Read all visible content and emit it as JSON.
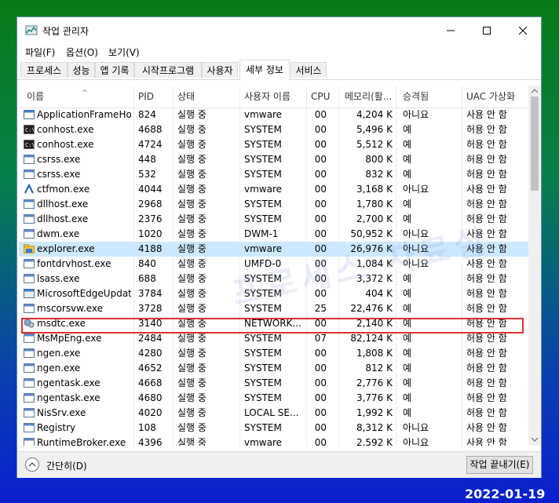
{
  "window": {
    "title": "작업 관리자",
    "controls": [
      "minimize-icon",
      "maximize-icon",
      "close-icon"
    ]
  },
  "menu": [
    "파일(F)",
    "옵션(O)",
    "보기(V)"
  ],
  "tabs": [
    "프로세스",
    "성능",
    "앱 기록",
    "시작프로그램",
    "사용자",
    "세부 정보",
    "서비스"
  ],
  "active_tab": "세부 정보",
  "columns": [
    "이름",
    "PID",
    "상태",
    "사용자 이름",
    "CPU",
    "메모리(활...",
    "승격됨",
    "UAC 가상화"
  ],
  "rows": [
    {
      "icon": "app-frame-icon",
      "name": "ApplicationFrameHo...",
      "pid": "824",
      "status": "실행 중",
      "user": "vmware",
      "cpu": "00",
      "mem": "4,204 K",
      "elev": "아니요",
      "uac": "사용 안 함"
    },
    {
      "icon": "console-icon",
      "name": "conhost.exe",
      "pid": "4688",
      "status": "실행 중",
      "user": "SYSTEM",
      "cpu": "00",
      "mem": "5,496 K",
      "elev": "예",
      "uac": "허용 안 함"
    },
    {
      "icon": "console-icon",
      "name": "conhost.exe",
      "pid": "4724",
      "status": "실행 중",
      "user": "SYSTEM",
      "cpu": "00",
      "mem": "5,512 K",
      "elev": "예",
      "uac": "허용 안 함"
    },
    {
      "icon": "window-icon",
      "name": "csrss.exe",
      "pid": "448",
      "status": "실행 중",
      "user": "SYSTEM",
      "cpu": "00",
      "mem": "800 K",
      "elev": "예",
      "uac": "허용 안 함"
    },
    {
      "icon": "window-icon",
      "name": "csrss.exe",
      "pid": "532",
      "status": "실행 중",
      "user": "SYSTEM",
      "cpu": "00",
      "mem": "832 K",
      "elev": "예",
      "uac": "허용 안 함"
    },
    {
      "icon": "ctfmon-icon",
      "name": "ctfmon.exe",
      "pid": "4044",
      "status": "실행 중",
      "user": "vmware",
      "cpu": "00",
      "mem": "3,168 K",
      "elev": "아니요",
      "uac": "사용 안 함"
    },
    {
      "icon": "window-icon",
      "name": "dllhost.exe",
      "pid": "2968",
      "status": "실행 중",
      "user": "SYSTEM",
      "cpu": "00",
      "mem": "1,780 K",
      "elev": "예",
      "uac": "허용 안 함"
    },
    {
      "icon": "window-icon",
      "name": "dllhost.exe",
      "pid": "2376",
      "status": "실행 중",
      "user": "SYSTEM",
      "cpu": "00",
      "mem": "2,700 K",
      "elev": "예",
      "uac": "허용 안 함"
    },
    {
      "icon": "window-icon",
      "name": "dwm.exe",
      "pid": "1020",
      "status": "실행 중",
      "user": "DWM-1",
      "cpu": "00",
      "mem": "50,952 K",
      "elev": "아니요",
      "uac": "사용 안 함"
    },
    {
      "icon": "folder-icon",
      "name": "explorer.exe",
      "pid": "4188",
      "status": "실행 중",
      "user": "vmware",
      "cpu": "00",
      "mem": "26,976 K",
      "elev": "아니요",
      "uac": "사용 안 함",
      "selected": true
    },
    {
      "icon": "window-icon",
      "name": "fontdrvhost.exe",
      "pid": "840",
      "status": "실행 중",
      "user": "UMFD-0",
      "cpu": "00",
      "mem": "1,084 K",
      "elev": "아니요",
      "uac": "사용 안 함"
    },
    {
      "icon": "window-icon",
      "name": "lsass.exe",
      "pid": "688",
      "status": "실행 중",
      "user": "SYSTEM",
      "cpu": "00",
      "mem": "3,372 K",
      "elev": "예",
      "uac": "허용 안 함"
    },
    {
      "icon": "edge-update-icon",
      "name": "MicrosoftEdgeUpdat...",
      "pid": "3784",
      "status": "실행 중",
      "user": "SYSTEM",
      "cpu": "00",
      "mem": "404 K",
      "elev": "예",
      "uac": "허용 안 함"
    },
    {
      "icon": "window-icon",
      "name": "mscorsvw.exe",
      "pid": "3728",
      "status": "실행 중",
      "user": "SYSTEM",
      "cpu": "25",
      "mem": "22,476 K",
      "elev": "예",
      "uac": "허용 안 함"
    },
    {
      "icon": "msdtc-icon",
      "name": "msdtc.exe",
      "pid": "3140",
      "status": "실행 중",
      "user": "NETWORK...",
      "cpu": "00",
      "mem": "2,140 K",
      "elev": "예",
      "uac": "허용 안 함"
    },
    {
      "icon": "window-icon",
      "name": "MsMpEng.exe",
      "pid": "2484",
      "status": "실행 중",
      "user": "SYSTEM",
      "cpu": "07",
      "mem": "82,124 K",
      "elev": "예",
      "uac": "허용 안 함"
    },
    {
      "icon": "window-icon",
      "name": "ngen.exe",
      "pid": "4280",
      "status": "실행 중",
      "user": "SYSTEM",
      "cpu": "00",
      "mem": "1,808 K",
      "elev": "예",
      "uac": "허용 안 함"
    },
    {
      "icon": "window-icon",
      "name": "ngen.exe",
      "pid": "4652",
      "status": "실행 중",
      "user": "SYSTEM",
      "cpu": "00",
      "mem": "812 K",
      "elev": "예",
      "uac": "허용 안 함"
    },
    {
      "icon": "window-icon",
      "name": "ngentask.exe",
      "pid": "4668",
      "status": "실행 중",
      "user": "SYSTEM",
      "cpu": "00",
      "mem": "2,776 K",
      "elev": "예",
      "uac": "허용 안 함"
    },
    {
      "icon": "window-icon",
      "name": "ngentask.exe",
      "pid": "4680",
      "status": "실행 중",
      "user": "SYSTEM",
      "cpu": "00",
      "mem": "3,776 K",
      "elev": "예",
      "uac": "허용 안 함"
    },
    {
      "icon": "window-icon",
      "name": "NisSrv.exe",
      "pid": "4020",
      "status": "실행 중",
      "user": "LOCAL SE...",
      "cpu": "00",
      "mem": "1,992 K",
      "elev": "예",
      "uac": "허용 안 함"
    },
    {
      "icon": "window-icon",
      "name": "Registry",
      "pid": "108",
      "status": "실행 중",
      "user": "SYSTEM",
      "cpu": "00",
      "mem": "8,312 K",
      "elev": "아니요",
      "uac": "사용 안 함"
    },
    {
      "icon": "window-icon",
      "name": "RuntimeBroker.exe",
      "pid": "4396",
      "status": "실행 중",
      "user": "vmware",
      "cpu": "00",
      "mem": "2,592 K",
      "elev": "아니요",
      "uac": "사용 안 함"
    }
  ],
  "footer": {
    "collapse_label": "간단히(D)",
    "end_task_label": "작업 끝내기(E)"
  },
  "watermark": "프로세스 자료실",
  "date_stamp": "2022-01-19",
  "colors": {
    "selected_row": "#cce8ff",
    "highlight_border": "#e03030"
  }
}
